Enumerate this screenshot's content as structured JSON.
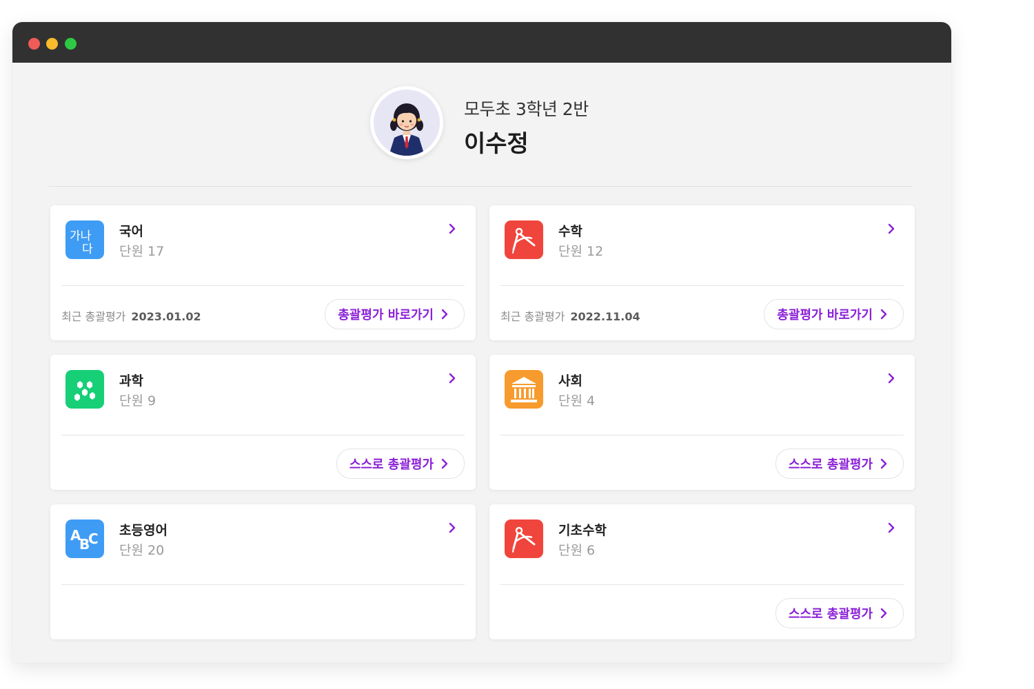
{
  "window": {
    "traffic_lights": [
      "close",
      "minimize",
      "maximize"
    ]
  },
  "profile": {
    "school_class": "모두초 3학년 2반",
    "name": "이수정"
  },
  "colors": {
    "accent": "#8a1fd6",
    "titlebar": "#313131",
    "korean_icon": "#3f9cf5",
    "math_icon": "#f0453c",
    "science_icon": "#16cf77",
    "social_icon": "#f79b2e",
    "english_icon": "#3f9cf5"
  },
  "cards": [
    {
      "subject": "국어",
      "units": "단원 17",
      "icon": "hangul-icon",
      "recent_label": "최근 총괄평가",
      "recent_date": "2023.01.02",
      "action": "총괄평가 바로가기"
    },
    {
      "subject": "수학",
      "units": "단원 12",
      "icon": "compass-icon",
      "recent_label": "최근 총괄평가",
      "recent_date": "2022.11.04",
      "action": "총괄평가 바로가기"
    },
    {
      "subject": "과학",
      "units": "단원 9",
      "icon": "molecule-icon",
      "action": "스스로 총괄평가"
    },
    {
      "subject": "사회",
      "units": "단원 4",
      "icon": "building-icon",
      "action": "스스로 총괄평가"
    },
    {
      "subject": "초등영어",
      "units": "단원 20",
      "icon": "abc-icon"
    },
    {
      "subject": "기초수학",
      "units": "단원 6",
      "icon": "compass-icon",
      "action": "스스로 총괄평가"
    }
  ],
  "icon_text": {
    "hangul": "가나다",
    "abc": "ABC"
  }
}
